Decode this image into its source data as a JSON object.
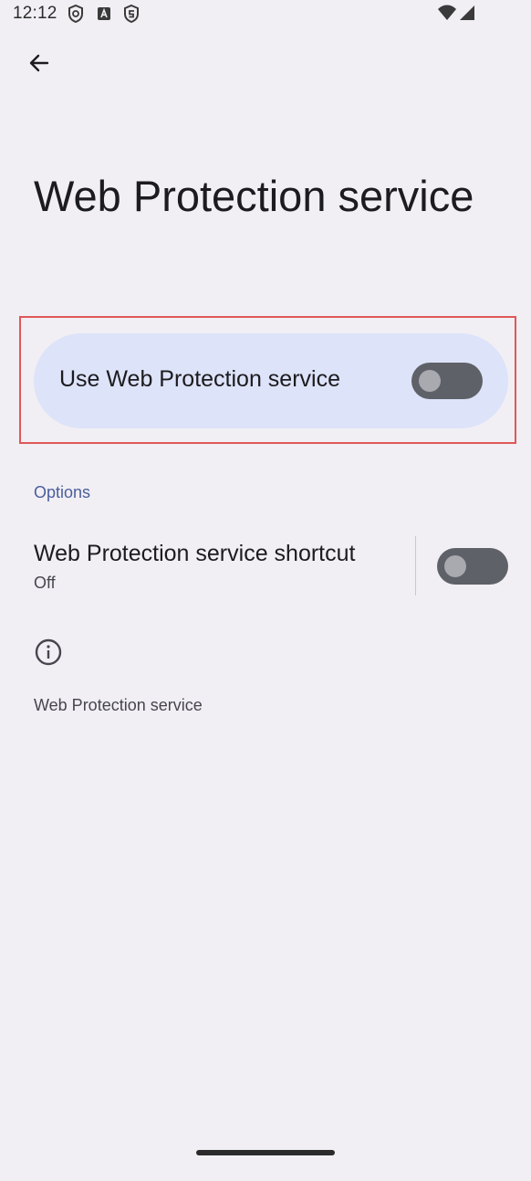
{
  "status_bar": {
    "time": "12:12",
    "left_icons": [
      "shield-icon",
      "a-badge-icon",
      "security-shield-icon"
    ],
    "right_icons": [
      "wifi-icon",
      "cellular-signal-icon"
    ]
  },
  "header": {
    "back_icon": "arrow-back-icon",
    "title": "Web Protection service"
  },
  "main_switch": {
    "label": "Use Web Protection service",
    "state": "off"
  },
  "options_section": {
    "header": "Options",
    "shortcut": {
      "title": "Web Protection service shortcut",
      "summary": "Off",
      "state": "off"
    }
  },
  "footer": {
    "icon": "info-icon",
    "text": "Web Protection service"
  },
  "colors": {
    "background": "#f1eff4",
    "card": "#dde3f8",
    "accent_text": "#4b5e9b",
    "toggle_track_off": "#5f6168",
    "toggle_knob_off": "#a9a9b0",
    "highlight": "#e05757"
  }
}
